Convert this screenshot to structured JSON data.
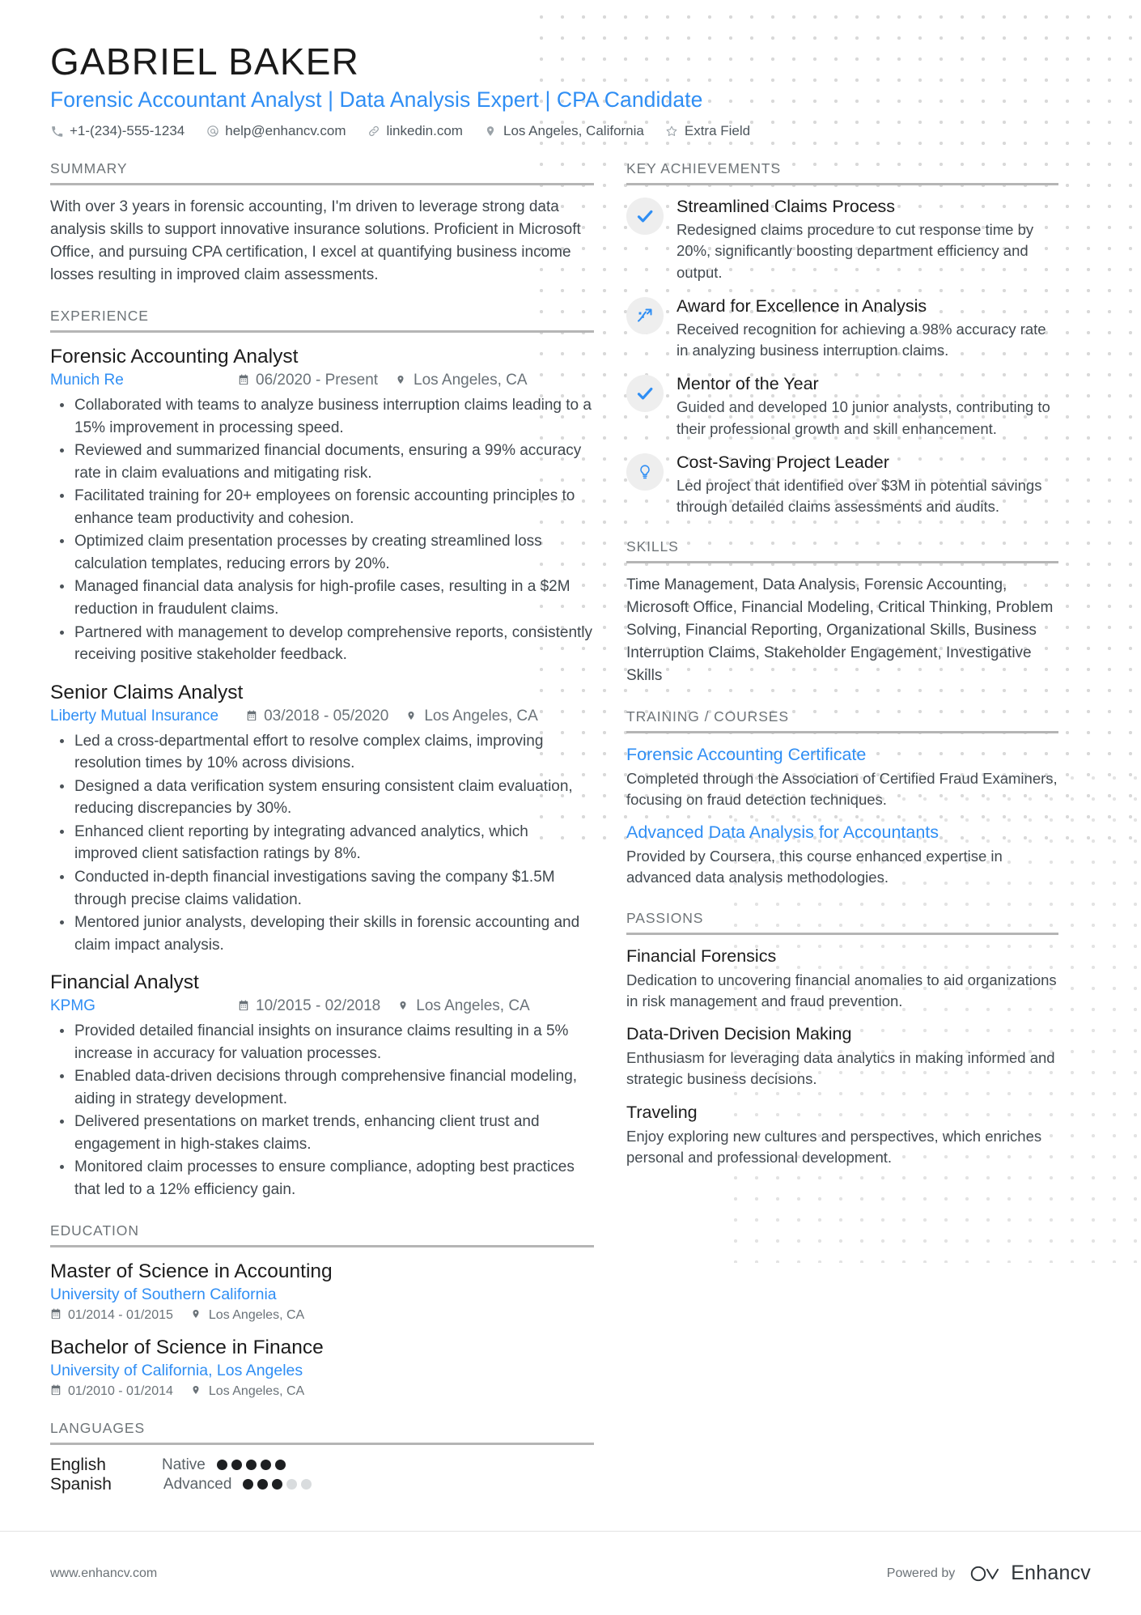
{
  "header": {
    "name": "GABRIEL BAKER",
    "headline": "Forensic Accountant Analyst | Data Analysis Expert | CPA Candidate",
    "contacts": [
      {
        "icon": "phone-icon",
        "text": "+1-(234)-555-1234"
      },
      {
        "icon": "email-icon",
        "text": "help@enhancv.com"
      },
      {
        "icon": "link-icon",
        "text": "linkedin.com"
      },
      {
        "icon": "location-icon",
        "text": "Los Angeles, California"
      },
      {
        "icon": "star-icon",
        "text": "Extra Field"
      }
    ]
  },
  "accent_color": "#2f8ef4",
  "summary": {
    "title": "SUMMARY",
    "text": "With over 3 years in forensic accounting, I'm driven to leverage strong data analysis skills to support innovative insurance solutions. Proficient in Microsoft Office, and pursuing CPA certification, I excel at quantifying business income losses resulting in improved claim assessments."
  },
  "experience": {
    "title": "EXPERIENCE",
    "entries": [
      {
        "role": "Forensic Accounting Analyst",
        "company": "Munich Re",
        "dates": "06/2020 - Present",
        "location": "Los Angeles, CA",
        "bullets": [
          "Collaborated with teams to analyze business interruption claims leading to a 15% improvement in processing speed.",
          "Reviewed and summarized financial documents, ensuring a 99% accuracy rate in claim evaluations and mitigating risk.",
          "Facilitated training for 20+ employees on forensic accounting principles to enhance team productivity and cohesion.",
          "Optimized claim presentation processes by creating streamlined loss calculation templates, reducing errors by 20%.",
          "Managed financial data analysis for high-profile cases, resulting in a $2M reduction in fraudulent claims.",
          "Partnered with management to develop comprehensive reports, consistently receiving positive stakeholder feedback."
        ]
      },
      {
        "role": "Senior Claims Analyst",
        "company": "Liberty Mutual Insurance",
        "dates": "03/2018 - 05/2020",
        "location": "Los Angeles, CA",
        "bullets": [
          "Led a cross-departmental effort to resolve complex claims, improving resolution times by 10% across divisions.",
          "Designed a data verification system ensuring consistent claim evaluation, reducing discrepancies by 30%.",
          "Enhanced client reporting by integrating advanced analytics, which improved client satisfaction ratings by 8%.",
          "Conducted in-depth financial investigations saving the company $1.5M through precise claims validation.",
          "Mentored junior analysts, developing their skills in forensic accounting and claim impact analysis."
        ]
      },
      {
        "role": "Financial Analyst",
        "company": "KPMG",
        "dates": "10/2015 - 02/2018",
        "location": "Los Angeles, CA",
        "bullets": [
          "Provided detailed financial insights on insurance claims resulting in a 5% increase in accuracy for valuation processes.",
          "Enabled data-driven decisions through comprehensive financial modeling, aiding in strategy development.",
          "Delivered presentations on market trends, enhancing client trust and engagement in high-stakes claims.",
          "Monitored claim processes to ensure compliance, adopting best practices that led to a 12% efficiency gain."
        ]
      }
    ]
  },
  "education": {
    "title": "EDUCATION",
    "entries": [
      {
        "degree": "Master of Science in Accounting",
        "school": "University of Southern California",
        "dates": "01/2014 - 01/2015",
        "location": "Los Angeles, CA"
      },
      {
        "degree": "Bachelor of Science in Finance",
        "school": "University of California, Los Angeles",
        "dates": "01/2010 - 01/2014",
        "location": "Los Angeles, CA"
      }
    ]
  },
  "languages": {
    "title": "LANGUAGES",
    "items": [
      {
        "name": "English",
        "level": "Native",
        "filled": 5,
        "total": 5
      },
      {
        "name": "Spanish",
        "level": "Advanced",
        "filled": 3,
        "total": 5
      }
    ]
  },
  "key_achievements": {
    "title": "KEY ACHIEVEMENTS",
    "items": [
      {
        "icon": "check-icon",
        "title": "Streamlined Claims Process",
        "desc": "Redesigned claims procedure to cut response time by 20%, significantly boosting department efficiency and output."
      },
      {
        "icon": "trending-up-icon",
        "title": "Award for Excellence in Analysis",
        "desc": "Received recognition for achieving a 98% accuracy rate in analyzing business interruption claims."
      },
      {
        "icon": "check-icon",
        "title": "Mentor of the Year",
        "desc": "Guided and developed 10 junior analysts, contributing to their professional growth and skill enhancement."
      },
      {
        "icon": "lightbulb-icon",
        "title": "Cost-Saving Project Leader",
        "desc": "Led project that identified over $3M in potential savings through detailed claims assessments and audits."
      }
    ]
  },
  "skills": {
    "title": "SKILLS",
    "text": "Time Management, Data Analysis, Forensic Accounting, Microsoft Office, Financial Modeling, Critical Thinking, Problem Solving, Financial Reporting, Organizational Skills, Business Interruption Claims, Stakeholder Engagement, Investigative Skills"
  },
  "training": {
    "title": "TRAINING / COURSES",
    "items": [
      {
        "name": "Forensic Accounting Certificate",
        "desc": "Completed through the Association of Certified Fraud Examiners, focusing on fraud detection techniques."
      },
      {
        "name": "Advanced Data Analysis for Accountants",
        "desc": "Provided by Coursera, this course enhanced expertise in advanced data analysis methodologies."
      }
    ]
  },
  "passions": {
    "title": "PASSIONS",
    "items": [
      {
        "name": "Financial Forensics",
        "desc": "Dedication to uncovering financial anomalies to aid organizations in risk management and fraud prevention."
      },
      {
        "name": "Data-Driven Decision Making",
        "desc": "Enthusiasm for leveraging data analytics in making informed and strategic business decisions."
      },
      {
        "name": "Traveling",
        "desc": "Enjoy exploring new cultures and perspectives, which enriches personal and professional development."
      }
    ]
  },
  "footer": {
    "website": "www.enhancv.com",
    "powered_by": "Powered by",
    "brand": "Enhancv"
  }
}
